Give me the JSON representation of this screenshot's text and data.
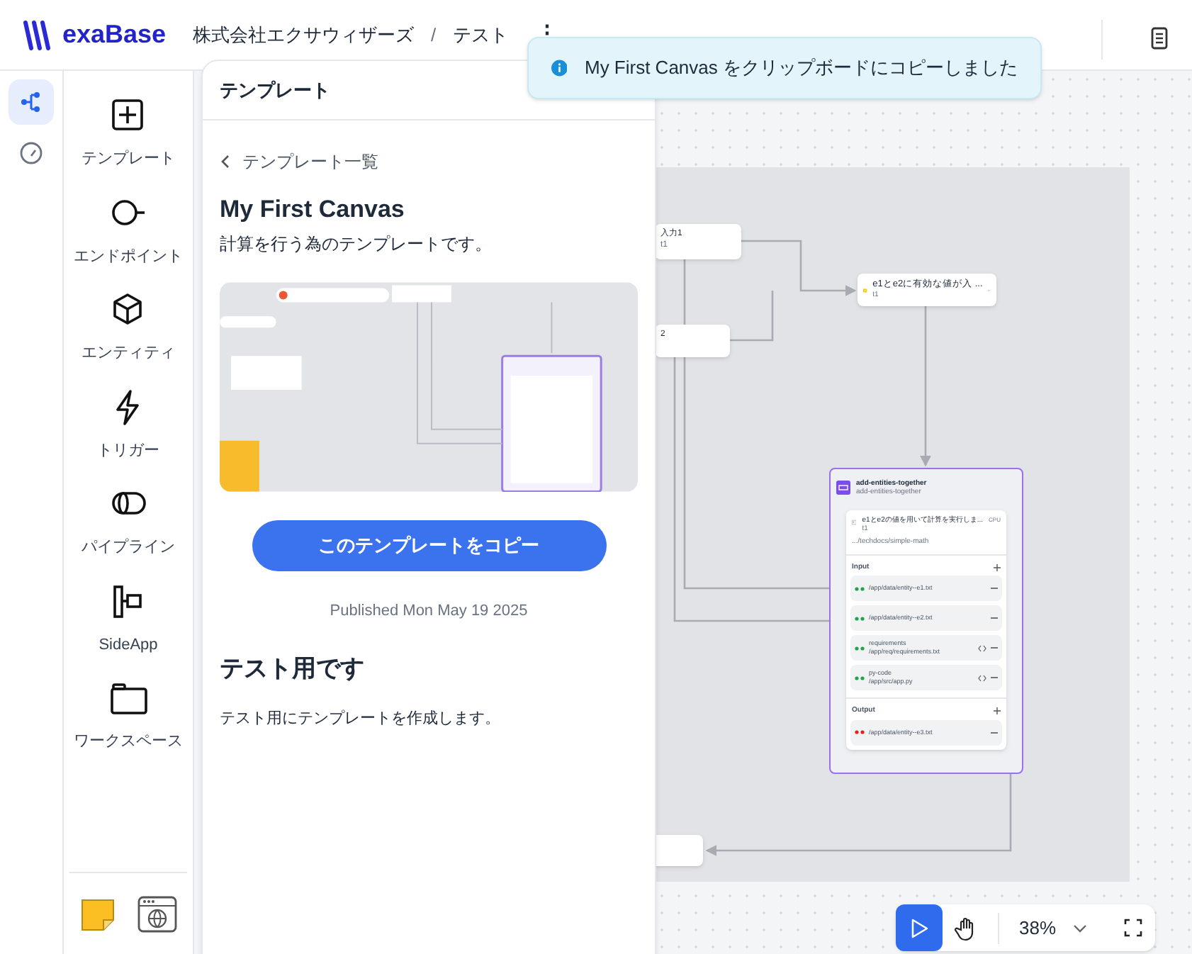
{
  "header": {
    "logo": "exaBase",
    "breadcrumb": [
      "株式会社エクサウィザーズ",
      "テスト"
    ],
    "separator": "/",
    "menu": "⋮"
  },
  "toast": {
    "message": "My First Canvas をクリップボードにコピーしました"
  },
  "rail": [
    {
      "kind": "flow",
      "selected": true
    },
    {
      "kind": "gauge",
      "selected": false
    }
  ],
  "palette": [
    {
      "kind": "template",
      "label": "テンプレート"
    },
    {
      "kind": "endpoint",
      "label": "エンドポイント"
    },
    {
      "kind": "entity",
      "label": "エンティティ"
    },
    {
      "kind": "trigger",
      "label": "トリガー"
    },
    {
      "kind": "pipeline",
      "label": "パイプライン"
    },
    {
      "kind": "sideapp",
      "label": "SideApp"
    },
    {
      "kind": "workspace",
      "label": "ワークスペース"
    }
  ],
  "palette_tools": [
    {
      "kind": "sticky"
    },
    {
      "kind": "web"
    }
  ],
  "template_panel": {
    "title": "テンプレート",
    "back_link": "テンプレート一覧",
    "name": "My First Canvas",
    "description": "計算を行う為のテンプレートです。",
    "copy_button": "このテンプレートをコピー",
    "published": "Published Mon May 19 2025",
    "section_title": "テスト用です",
    "section_body": "テスト用にテンプレートを作成します。"
  },
  "canvas": {
    "input_nodes": [
      {
        "title": "入力1",
        "subtitle": "t1"
      },
      {
        "title": "2"
      }
    ],
    "trigger_node": {
      "title": "e1とe2に有効な値が入 ...",
      "subtitle": "t1"
    },
    "group": {
      "title": "add-entities-together",
      "subtitle": "add-entities-together",
      "function": {
        "title": "e1とe2の値を用いて計算を実行しま...",
        "subtitle": "t1",
        "badge": "CPU",
        "path": ".../techdocs/simple-math"
      },
      "input_label": "Input",
      "inputs": [
        {
          "kind": "linked",
          "path": "/app/data/entity--e1.txt"
        },
        {
          "kind": "linked",
          "path": "/app/data/entity--e2.txt"
        },
        {
          "kind": "code",
          "name": "requirements",
          "path": "/app/req/requirements.txt"
        },
        {
          "kind": "code",
          "name": "py-code",
          "path": "/app/src/app.py"
        }
      ],
      "output_label": "Output",
      "outputs": [
        {
          "path": "/app/data/entity--e3.txt"
        }
      ]
    }
  },
  "zoom_controls": {
    "tools": [
      {
        "kind": "pointer",
        "selected": true
      },
      {
        "kind": "hand",
        "selected": false
      }
    ],
    "zoom": "38%"
  }
}
